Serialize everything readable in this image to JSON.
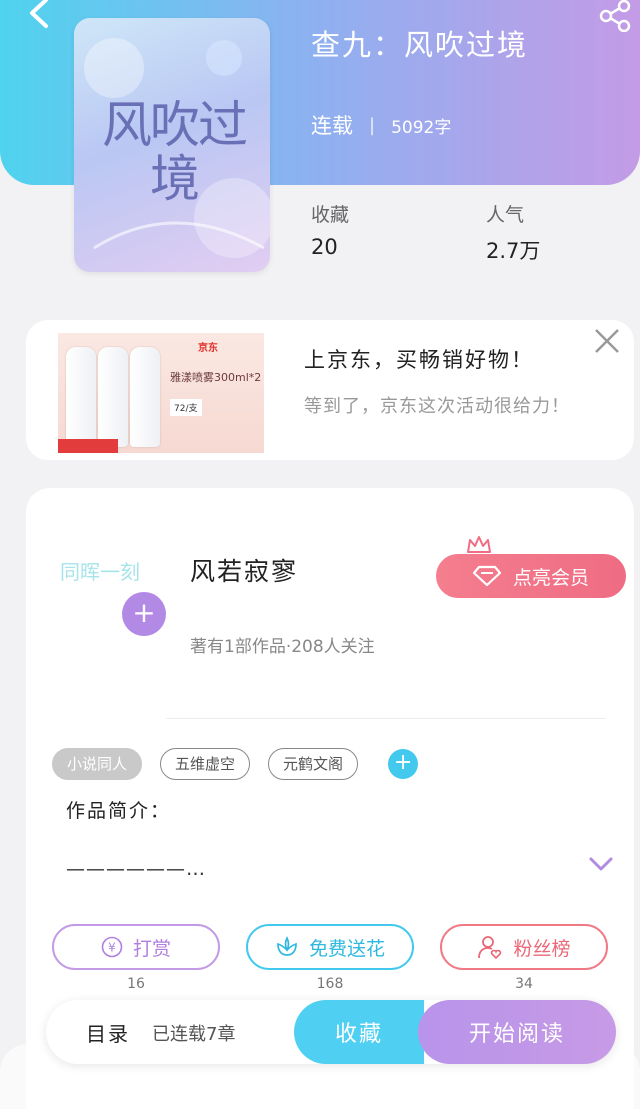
{
  "colors": {
    "header_gradient_start": "#4fd3ee",
    "header_gradient_end": "#c49be6",
    "reward": "#c29ae5",
    "flower": "#43c9ee",
    "fans": "#ef7a86",
    "vip": "#ef6c83"
  },
  "header": {
    "back_icon": "chevron-left-icon",
    "share_icon": "share-icon"
  },
  "book": {
    "cover_text": "风吹过境",
    "title": "查九：风吹过境",
    "status": "连载",
    "words": "5092字",
    "stats": [
      {
        "label": "收藏",
        "value": "20"
      },
      {
        "label": "人气",
        "value": "2.7万"
      }
    ]
  },
  "ad": {
    "brand": "京东",
    "product_text": "雅漾喷雾300ml*2",
    "price_text": "72/支",
    "title": "上京东，买畅销好物！",
    "subtitle": "等到了，京东这次活动很给力！",
    "close_icon": "close-icon"
  },
  "author": {
    "avatar_text": "同晖一刻",
    "name": "风若寂寥",
    "meta": "著有1部作品·208人关注",
    "vip_label": "点亮会员",
    "tags": [
      "小说同人",
      "五维虚空",
      "元鹤文阁"
    ],
    "intro_label": "作品简介：",
    "intro_text": "——————…"
  },
  "actions": [
    {
      "label": "打赏",
      "count": "16",
      "icon": "yen-icon"
    },
    {
      "label": "免费送花",
      "count": "168",
      "icon": "flower-icon"
    },
    {
      "label": "粉丝榜",
      "count": "34",
      "icon": "fan-icon"
    }
  ],
  "bottom_bar": {
    "toc_label": "目录",
    "toc_status": "已连载7章",
    "favorite_label": "收藏",
    "read_label": "开始阅读"
  }
}
